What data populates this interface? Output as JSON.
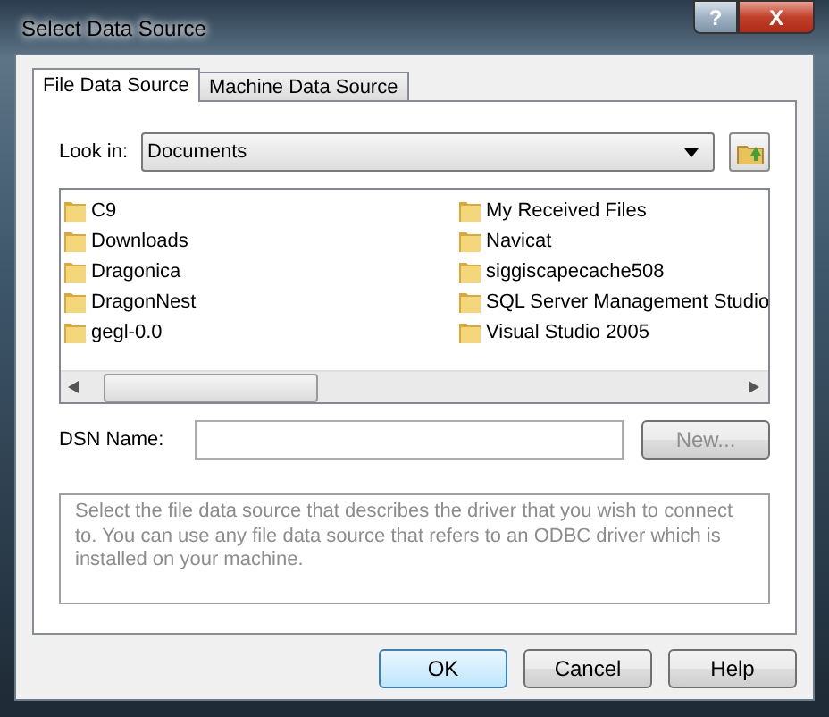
{
  "window": {
    "title": "Select Data Source"
  },
  "title_buttons": [
    {
      "label": "?",
      "kind": "help"
    },
    {
      "label": "X",
      "kind": "close"
    }
  ],
  "tabs": [
    {
      "label": "File Data Source",
      "selected": true
    },
    {
      "label": "Machine Data Source",
      "selected": false
    }
  ],
  "look_in": {
    "label": "Look in:",
    "value": "Documents"
  },
  "files": [
    {
      "name": "C9"
    },
    {
      "name": "Downloads"
    },
    {
      "name": "Dragonica"
    },
    {
      "name": "DragonNest"
    },
    {
      "name": "gegl-0.0"
    },
    {
      "name": "My Received Files"
    },
    {
      "name": "Navicat"
    },
    {
      "name": "siggiscapecache508"
    },
    {
      "name": "SQL Server Management Studio"
    },
    {
      "name": "Visual Studio 2005"
    }
  ],
  "dsn": {
    "label": "DSN Name:"
  },
  "new_button": {
    "label": "New...",
    "disabled": true
  },
  "description": "Select the file data source that describes the driver that you wish to connect to. You can use any file data source that refers to an ODBC driver which is installed on your machine.",
  "buttons": [
    {
      "label": "OK",
      "default": true
    },
    {
      "label": "Cancel",
      "default": false
    },
    {
      "label": "Help",
      "default": false
    }
  ]
}
